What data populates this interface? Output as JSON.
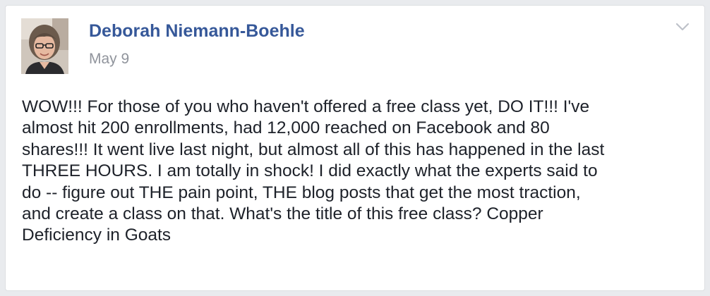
{
  "post": {
    "author": "Deborah Niemann-Boehle",
    "date": "May 9",
    "menu_icon": "chevron-down-icon",
    "avatar_icon": "profile-photo",
    "lines": [
      "WOW!!! For those of you who haven't offered a free class yet, DO IT!!! I've",
      "almost hit 200 enrollments, had 12,000 reached on Facebook and 80",
      "shares!!! It went live last night, but almost all of this has happened in the last",
      "THREE HOURS. I am totally in shock! I did exactly what the experts said to",
      "do -- figure out THE pain point, THE blog posts that get the most traction,",
      "and create a class on that. What's the title of this free class? Copper",
      "Deficiency in Goats"
    ]
  },
  "colors": {
    "author_link": "#365899",
    "meta_text": "#90949c",
    "body_text": "#1d2129",
    "card_border": "#dddfe2",
    "page_background": "#e9ebee"
  }
}
